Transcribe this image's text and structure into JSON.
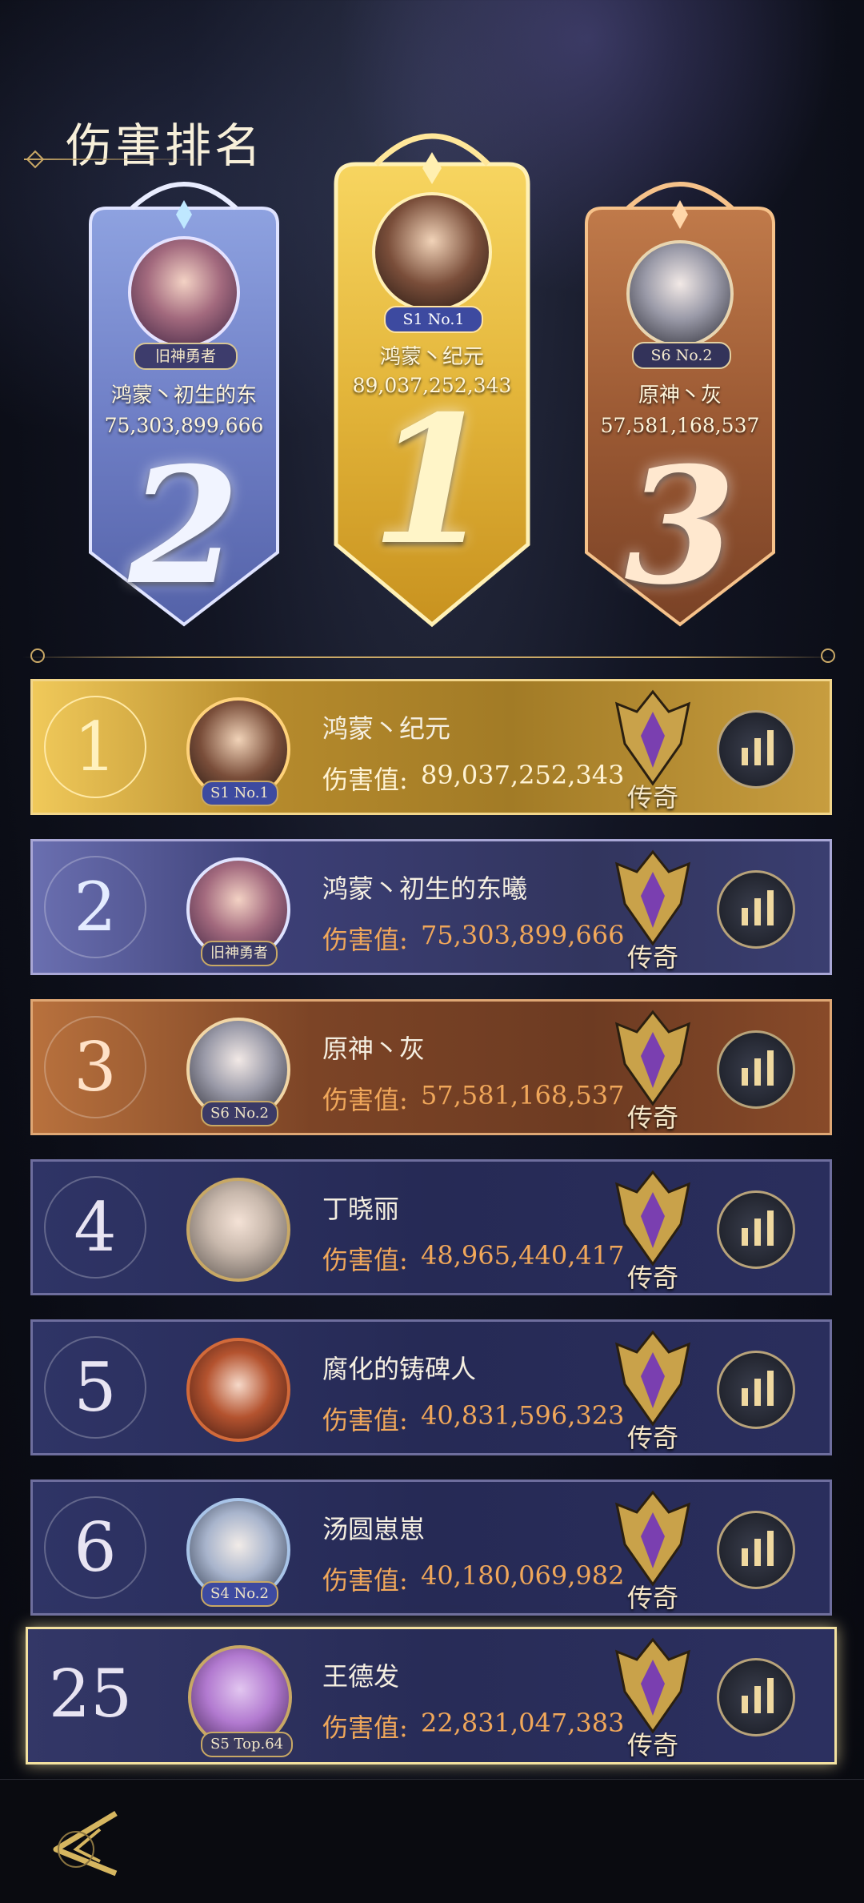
{
  "page_title": "伤害排名",
  "podium": [
    {
      "rank_text": "2",
      "name": "鸿蒙丶初生的东",
      "score": "75,303,899,666",
      "badge": "旧神勇者"
    },
    {
      "rank_text": "1",
      "name": "鸿蒙丶纪元",
      "score": "89,037,252,343",
      "badge": "S1 No.1"
    },
    {
      "rank_text": "3",
      "name": "原神丶灰",
      "score": "57,581,168,537",
      "badge": "S6 No.2"
    }
  ],
  "score_label": "伤害值:",
  "rows": [
    {
      "rank": "1",
      "name": "鸿蒙丶纪元",
      "score": "89,037,252,343",
      "badge": "S1 No.1",
      "title": "传奇"
    },
    {
      "rank": "2",
      "name": "鸿蒙丶初生的东曦",
      "score": "75,303,899,666",
      "badge": "旧神勇者",
      "title": "传奇"
    },
    {
      "rank": "3",
      "name": "原神丶灰",
      "score": "57,581,168,537",
      "badge": "S6 No.2",
      "title": "传奇"
    },
    {
      "rank": "4",
      "name": "丁晓丽",
      "score": "48,965,440,417",
      "badge": "",
      "title": "传奇"
    },
    {
      "rank": "5",
      "name": "腐化的铸碑人",
      "score": "40,831,596,323",
      "badge": "",
      "title": "传奇"
    },
    {
      "rank": "6",
      "name": "汤圆崽崽",
      "score": "40,180,069,982",
      "badge": "S4 No.2",
      "title": "传奇"
    },
    {
      "rank": "25",
      "name": "王德发",
      "score": "22,831,047,383",
      "badge": "S5 Top.64",
      "title": "传奇"
    }
  ]
}
